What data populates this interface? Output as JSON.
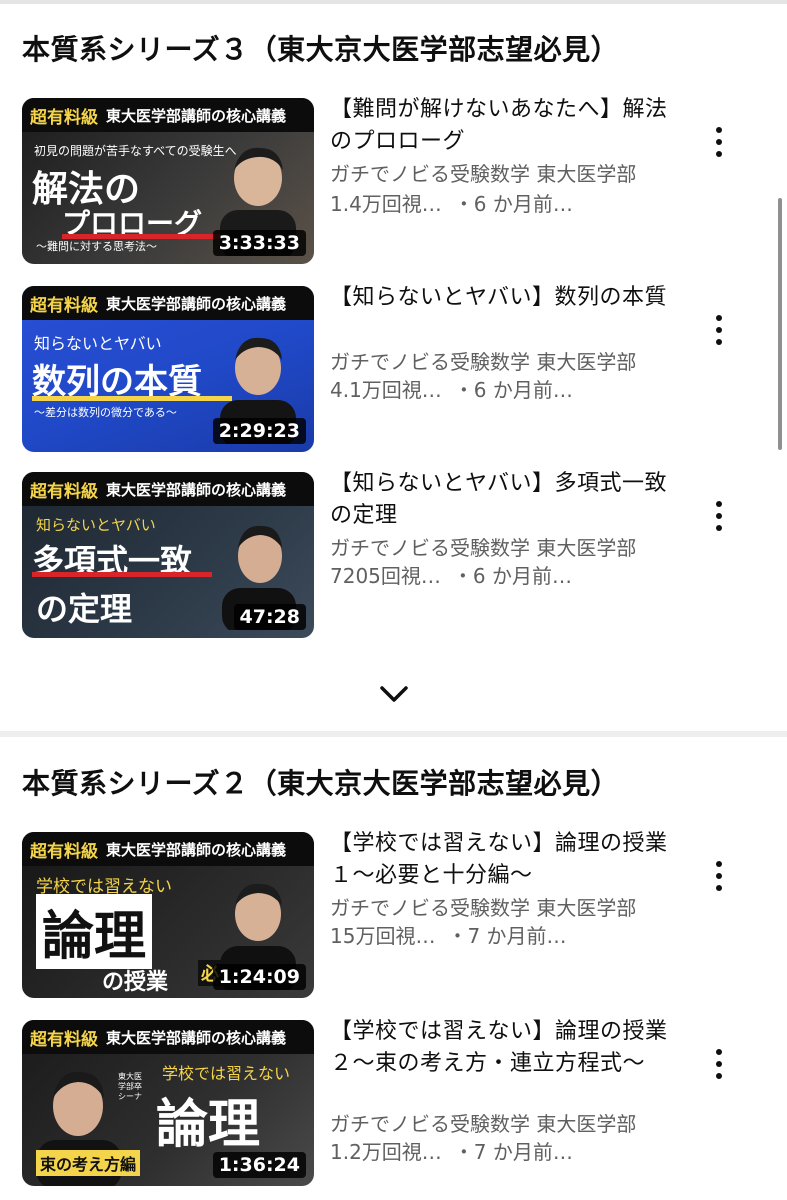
{
  "sections": [
    {
      "title": "本質系シリーズ３（東大京大医学部志望必見）",
      "videos": [
        {
          "title": "【難問が解けないあなたへ】解法のプロローグ",
          "channel": "ガチでノビる受験数学 東大医学部",
          "views": "1.4万回視…",
          "age": "・6 か月前…",
          "duration": "3:33:33",
          "thumb": {
            "banner_left": "超有料級",
            "banner_right": "東大医学部講師の核心講義",
            "top_text": "初見の問題が苦手なすべての受験生へ",
            "main_1": "解法の",
            "main_2": "プロローグ",
            "sub": "〜難問に対する思考法〜"
          }
        },
        {
          "title": "【知らないとヤバい】数列の本質",
          "channel": "ガチでノビる受験数学 東大医学部",
          "views": "4.1万回視…",
          "age": "・6 か月前…",
          "duration": "2:29:23",
          "thumb": {
            "banner_left": "超有料級",
            "banner_right": "東大医学部講師の核心講義",
            "top_text": "知らないとヤバい",
            "main_1": "数列の本質",
            "sub": "〜差分は数列の微分である〜"
          }
        },
        {
          "title": "【知らないとヤバい】多項式一致の定理",
          "channel": "ガチでノビる受験数学 東大医学部",
          "views": "7205回視…",
          "age": "・6 か月前…",
          "duration": "47:28",
          "thumb": {
            "banner_left": "超有料級",
            "banner_right": "東大医学部講師の核心講義",
            "top_text": "知らないとヤバい",
            "main_1": "多項式一致",
            "main_2": "の定理"
          }
        }
      ]
    },
    {
      "title": "本質系シリーズ２（東大京大医学部志望必見）",
      "videos": [
        {
          "title": "【学校では習えない】論理の授業１〜必要と十分編〜",
          "channel": "ガチでノビる受験数学 東大医学部",
          "views": "15万回視…",
          "age": "・7 か月前…",
          "duration": "1:24:09",
          "thumb": {
            "banner_left": "超有料級",
            "banner_right": "東大医学部講師の核心講義",
            "top_text": "学校では習えない",
            "main_1": "論理",
            "main_2": "の授業",
            "tag": "必要"
          }
        },
        {
          "title": "【学校では習えない】論理の授業２〜束の考え方・連立方程式〜",
          "channel": "ガチでノビる受験数学 東大医学部",
          "views": "1.2万回視…",
          "age": "・7 か月前…",
          "duration": "1:36:24",
          "thumb": {
            "banner_left": "超有料級",
            "banner_right": "東大医学部講師の核心講義",
            "top_text": "学校では習えない",
            "main_1": "論理",
            "tag": "束の考え方編",
            "small_text": "東大医学部卒 シーナ"
          }
        }
      ]
    }
  ],
  "colors": {
    "banner_yellow": "#f4d44a",
    "accent_red": "#d8252a",
    "thumb2_blue": "#2049c8",
    "meta_gray": "#606060"
  },
  "icons": {
    "more": "vertical-ellipsis-icon",
    "expand": "chevron-down-icon"
  }
}
